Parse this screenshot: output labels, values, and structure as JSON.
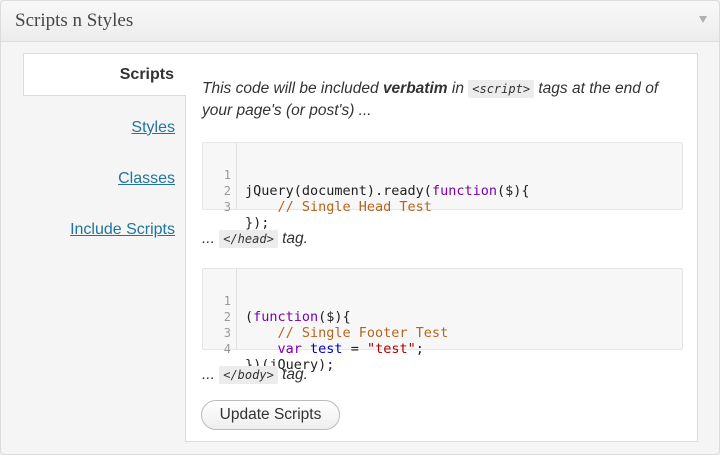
{
  "metabox": {
    "title": "Scripts n Styles",
    "toggle_icon": "triangle-down-icon"
  },
  "tabs": [
    {
      "label": "Scripts",
      "active": true
    },
    {
      "label": "Styles",
      "active": false
    },
    {
      "label": "Classes",
      "active": false
    },
    {
      "label": "Include Scripts",
      "active": false
    }
  ],
  "panel": {
    "intro_prefix": "This code will be included ",
    "intro_bold": "verbatim",
    "intro_mid": " in ",
    "intro_tag": "<script>",
    "intro_suffix": " tags at the end of your page's (or post's) ...",
    "head_prefix": "...",
    "head_tag": "</head>",
    "head_suffix": "tag.",
    "body_prefix": "...",
    "body_tag": "</body>",
    "body_suffix": "tag.",
    "button_label": "Update Scripts"
  },
  "head_editor": {
    "line_numbers": [
      "1",
      "2",
      "3"
    ],
    "l1_a": "jQuery(document).ready(",
    "l1_kw": "function",
    "l1_b": "($){",
    "l2": "    // Single Head Test",
    "l3": "});"
  },
  "footer_editor": {
    "line_numbers": [
      "1",
      "2",
      "3",
      "4"
    ],
    "l1_a": "(",
    "l1_kw": "function",
    "l1_b": "($){",
    "l2": "    // Single Footer Test",
    "l3_indent": "    ",
    "l3_kw": "var",
    "l3_sp": " ",
    "l3_var": "test",
    "l3_eq": " = ",
    "l3_str": "\"test\"",
    "l3_end": ";",
    "l4": "})(jQuery);"
  },
  "colors": {
    "link": "#21759b",
    "keyword": "#7a00a8",
    "comment": "#b5651d",
    "string": "#b00000",
    "variable": "#0000c0"
  }
}
